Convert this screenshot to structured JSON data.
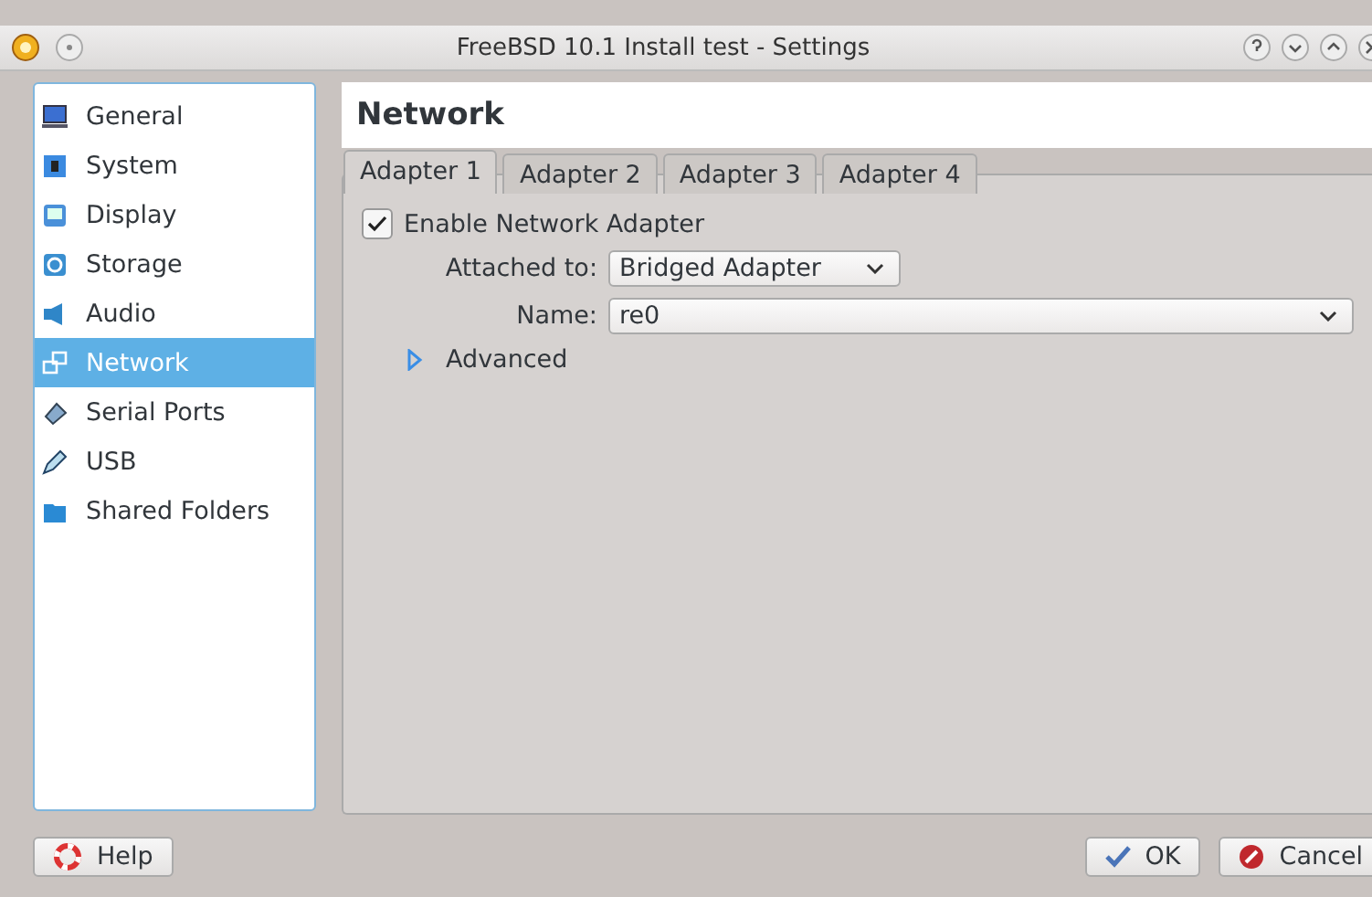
{
  "window": {
    "title": "FreeBSD 10.1 Install test - Settings"
  },
  "sidebar": {
    "items": [
      {
        "label": "General",
        "selected": false
      },
      {
        "label": "System",
        "selected": false
      },
      {
        "label": "Display",
        "selected": false
      },
      {
        "label": "Storage",
        "selected": false
      },
      {
        "label": "Audio",
        "selected": false
      },
      {
        "label": "Network",
        "selected": true
      },
      {
        "label": "Serial Ports",
        "selected": false
      },
      {
        "label": "USB",
        "selected": false
      },
      {
        "label": "Shared Folders",
        "selected": false
      }
    ]
  },
  "page": {
    "title": "Network"
  },
  "tabs": [
    {
      "label": "Adapter 1",
      "selected": true
    },
    {
      "label": "Adapter 2",
      "selected": false
    },
    {
      "label": "Adapter 3",
      "selected": false
    },
    {
      "label": "Adapter 4",
      "selected": false
    }
  ],
  "enable": {
    "label": "Enable Network Adapter",
    "checked": true
  },
  "attached": {
    "label": "Attached to:",
    "value": "Bridged Adapter"
  },
  "name": {
    "label": "Name:",
    "value": "re0"
  },
  "advanced": {
    "label": "Advanced",
    "expanded": false
  },
  "buttons": {
    "help": "Help",
    "ok": "OK",
    "cancel": "Cancel"
  }
}
